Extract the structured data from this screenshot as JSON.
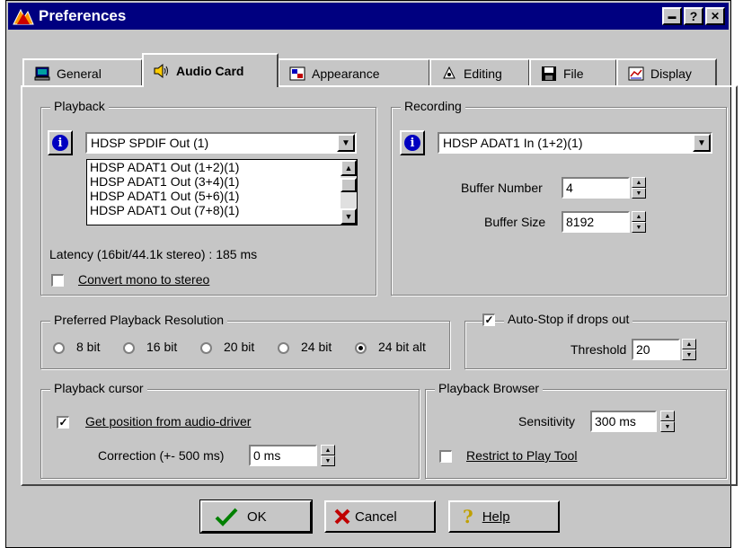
{
  "window": {
    "title": "Preferences",
    "btn_min": "▬",
    "btn_help": "?",
    "btn_close": "✕"
  },
  "tabs": [
    {
      "label": "General",
      "icon": "computer-icon"
    },
    {
      "label": "Audio Card",
      "icon": "speaker-icon"
    },
    {
      "label": "Appearance",
      "icon": "appearance-icon"
    },
    {
      "label": "Editing",
      "icon": "editing-icon"
    },
    {
      "label": "File",
      "icon": "floppy-icon"
    },
    {
      "label": "Display",
      "icon": "display-icon"
    }
  ],
  "playback": {
    "label": "Playback",
    "device": "HDSP SPDIF Out (1)",
    "options": [
      "HDSP ADAT1 Out (1+2)(1)",
      "HDSP ADAT1 Out (3+4)(1)",
      "HDSP ADAT1 Out (5+6)(1)",
      "HDSP ADAT1 Out (7+8)(1)"
    ],
    "latency": "Latency (16bit/44.1k stereo) : 185 ms",
    "convert_mono": "Convert mono to stereo",
    "convert_mono_checked": false
  },
  "recording": {
    "label": "Recording",
    "device": "HDSP ADAT1 In (1+2)(1)",
    "buffer_number_label": "Buffer Number",
    "buffer_number": "4",
    "buffer_size_label": "Buffer Size",
    "buffer_size": "8192"
  },
  "resolution": {
    "label": "Preferred Playback Resolution",
    "options": [
      "8 bit",
      "16 bit",
      "20 bit",
      "24 bit",
      "24 bit alt"
    ],
    "selected": "24 bit alt"
  },
  "autostop": {
    "label": "Auto-Stop if drops out",
    "checked": true,
    "threshold_label": "Threshold",
    "threshold": "20"
  },
  "cursor": {
    "label": "Playback cursor",
    "get_position": "Get position from audio-driver",
    "get_position_checked": true,
    "correction_label": "Correction (+- 500 ms)",
    "correction": "0 ms"
  },
  "browser": {
    "label": "Playback Browser",
    "sensitivity_label": "Sensitivity",
    "sensitivity": "300 ms",
    "restrict": "Restrict to Play Tool",
    "restrict_checked": false
  },
  "footer": {
    "ok": "OK",
    "cancel": "Cancel",
    "help": "Help"
  },
  "check_mark": "✓"
}
